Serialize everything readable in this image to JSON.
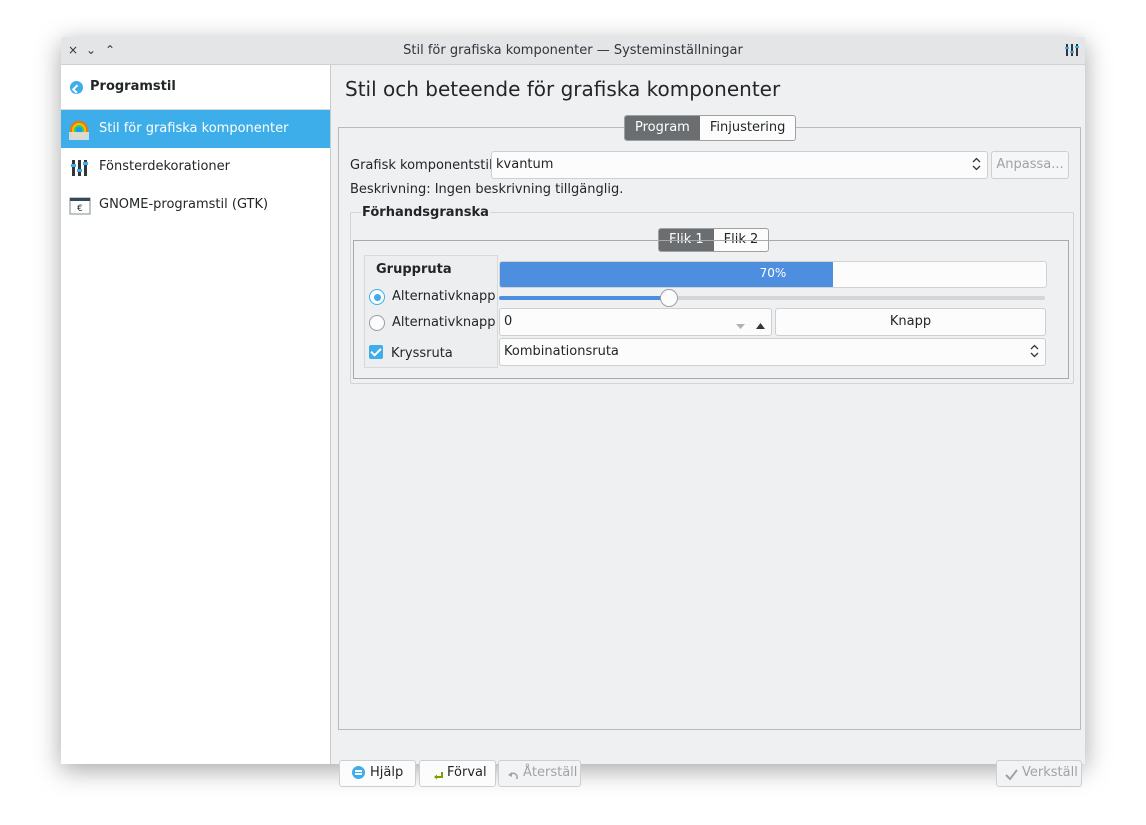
{
  "window": {
    "title": "Stil för grafiska komponenter — Systeminställningar"
  },
  "titlebar": {
    "close_glyph": "×",
    "minimize_glyph": "⌄",
    "maximize_glyph": "⌃"
  },
  "sidebar": {
    "back_label": "Programstil",
    "items": [
      {
        "label": "Stil för grafiska komponenter",
        "icon": "widget-style-icon",
        "selected": true
      },
      {
        "label": "Fönsterdekorationer",
        "icon": "window-decorations-icon",
        "selected": false
      },
      {
        "label": "GNOME-programstil (GTK)",
        "icon": "gtk-icon",
        "selected": false
      }
    ]
  },
  "main": {
    "title": "Stil och beteende för grafiska komponenter",
    "tabs": [
      {
        "label": "Program",
        "active": true
      },
      {
        "label": "Finjustering",
        "active": false
      }
    ],
    "style_label": "Grafisk komponentstil:",
    "style_value": "kvantum",
    "configure_label": "Anpassa...",
    "description": "Beskrivning: Ingen beskrivning tillgänglig.",
    "preview": {
      "title": "Förhandsgranska",
      "tabs": [
        {
          "label": "Flik 1",
          "active": true
        },
        {
          "label": "Flik 2",
          "active": false
        }
      ],
      "group_title": "Gruppruta",
      "radio1_label": "Alternativknapp",
      "radio2_label": "Alternativknapp",
      "checkbox_label": "Kryssruta",
      "progress_text": "70%",
      "progress_fraction": 0.61,
      "slider_fraction": 0.31,
      "spin_value": "0",
      "button_label": "Knapp",
      "combo_value": "Kombinationsruta"
    }
  },
  "footer": {
    "help_label": "Hjälp",
    "defaults_label": "Förval",
    "reset_label": "Återställ",
    "apply_label": "Verkställ"
  },
  "colors": {
    "accent": "#3daee9",
    "progress": "#4e8ede",
    "window_bg": "#eff0f1"
  }
}
